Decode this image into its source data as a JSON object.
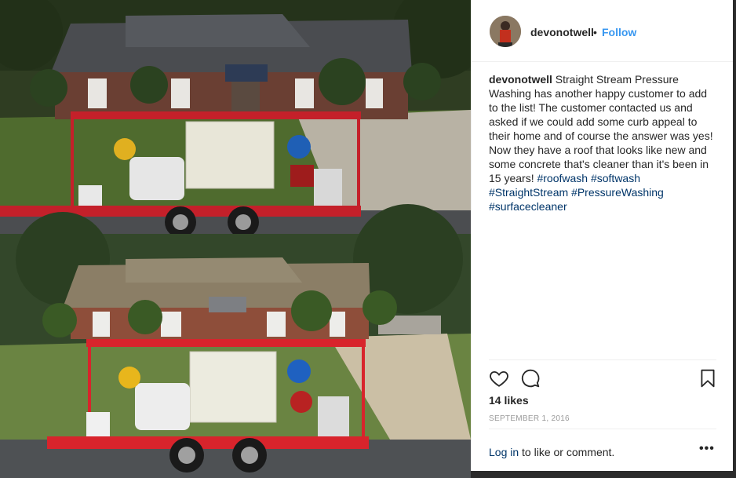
{
  "post": {
    "username": "devonotwell",
    "separator": "•",
    "follow_label": "Follow",
    "caption": {
      "username": "devonotwell",
      "text": " Straight Stream Pressure Washing has another happy customer to add to the list! The customer contacted us and asked if we could add some curb appeal to their home and of course the answer was yes! Now they have a roof that looks like new and some concrete that's cleaner than it's been in 15 years! ",
      "hashtags": [
        "#roofwash",
        "#softwash",
        "#StraightStream",
        "#PressureWashing",
        "#surfacecleaner"
      ]
    },
    "likes": "14 likes",
    "date": "SEPTEMBER 1, 2016",
    "footer": {
      "login_link": "Log in",
      "login_text": " to like or comment.",
      "more_label": "•••"
    }
  },
  "icons": {
    "like": "heart-icon",
    "comment": "comment-icon",
    "save": "bookmark-icon",
    "more": "more-options-icon"
  },
  "colors": {
    "link": "#3897f0",
    "hashtag": "#003569",
    "text": "#262626",
    "muted": "#999999",
    "trailer": "#c4202a"
  }
}
